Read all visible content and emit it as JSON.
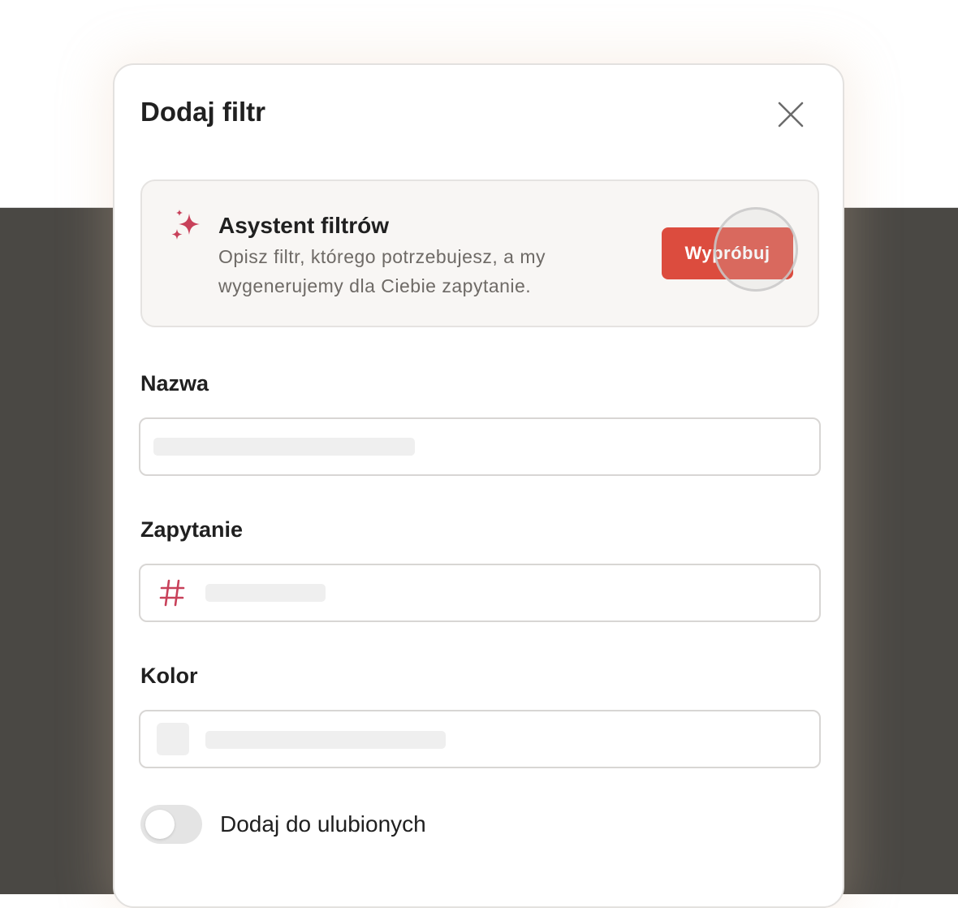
{
  "modal": {
    "title": "Dodaj filtr",
    "close_icon": "close-icon"
  },
  "assistant": {
    "icon": "sparkles-icon",
    "icon_color": "#c8415a",
    "title": "Asystent filtrów",
    "description": "Opisz filtr, którego potrzebujesz, a my wygenerujemy dla Ciebie zapytanie.",
    "button_label": "Wypróbuj",
    "button_color": "#dc4c3e"
  },
  "fields": {
    "name": {
      "label": "Nazwa",
      "value": ""
    },
    "query": {
      "label": "Zapytanie",
      "icon": "hash-icon",
      "icon_color": "#c8415a",
      "value": ""
    },
    "color": {
      "label": "Kolor",
      "value": ""
    }
  },
  "favorite": {
    "label": "Dodaj do ulubionych",
    "enabled": false
  }
}
